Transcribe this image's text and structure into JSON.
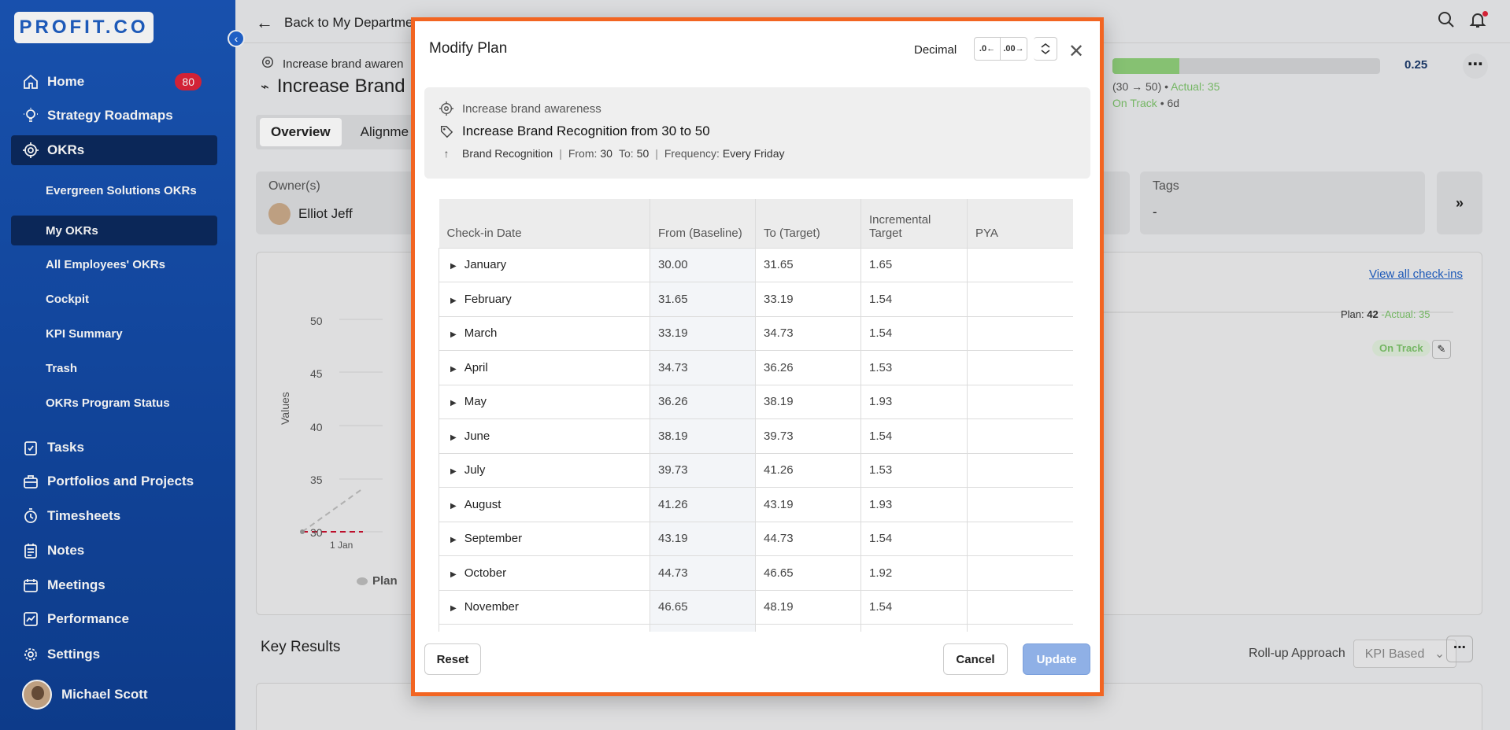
{
  "brand": {
    "logo_text": "PROFIT.CO"
  },
  "sidebar": {
    "items": [
      {
        "label": "Home",
        "badge": "80"
      },
      {
        "label": "Strategy Roadmaps"
      },
      {
        "label": "OKRs"
      },
      {
        "label": "Evergreen Solutions OKRs"
      },
      {
        "label": "My OKRs"
      },
      {
        "label": "All Employees' OKRs"
      },
      {
        "label": "Cockpit"
      },
      {
        "label": "KPI Summary"
      },
      {
        "label": "Trash"
      },
      {
        "label": "OKRs Program Status"
      },
      {
        "label": "Tasks"
      },
      {
        "label": "Portfolios and Projects"
      },
      {
        "label": "Timesheets"
      },
      {
        "label": "Notes"
      },
      {
        "label": "Meetings"
      },
      {
        "label": "Performance"
      },
      {
        "label": "Settings"
      }
    ],
    "user_name": "Michael Scott"
  },
  "topbar": {
    "back_label": "Back to My Departme"
  },
  "page": {
    "objective": "Increase brand awaren",
    "key_result": "Increase Brand",
    "tabs": [
      "Overview",
      "Alignme"
    ],
    "owner_label": "Owner(s)",
    "owner_name": "Elliot Jeff",
    "tags_label": "Tags",
    "tags_value": "-",
    "progress_value": "0.25",
    "progress_fraction": 0.25,
    "progress_range": "(30 → 50)",
    "progress_bullet": "•",
    "actual_text": "Actual: 35",
    "status_text": "On Track",
    "days_text": "6d",
    "view_all": "View all check-ins",
    "chart_y_ticks": [
      "50",
      "45",
      "40",
      "35",
      "30"
    ],
    "chart_y_label": "Values",
    "chart_x_tick": "1 Jan",
    "legend_plan": "Plan",
    "plan_label": "Plan:",
    "plan_value": "42",
    "plan_actual": "-Actual: 35",
    "status_pill": "On Track",
    "key_results_title": "Key Results",
    "rollup_label": "Roll-up Approach",
    "rollup_value": "KPI Based"
  },
  "modal": {
    "title": "Modify Plan",
    "decimal_label": "Decimal",
    "tool_decrease": ".0←",
    "tool_increase": ".00→",
    "summary": {
      "objective": "Increase brand awareness",
      "key_result": "Increase Brand Recognition from 30 to 50",
      "metric": "Brand Recognition",
      "from_label": "From:",
      "from_value": "30",
      "to_label": "To:",
      "to_value": "50",
      "frequency_label": "Frequency:",
      "frequency_value": "Every Friday"
    },
    "columns": [
      "Check-in Date",
      "From (Baseline)",
      "To (Target)",
      "Incremental Target",
      "PYA"
    ],
    "rows": [
      {
        "month": "January",
        "from": "30.00",
        "to": "31.65",
        "inc": "1.65",
        "pya": ""
      },
      {
        "month": "February",
        "from": "31.65",
        "to": "33.19",
        "inc": "1.54",
        "pya": ""
      },
      {
        "month": "March",
        "from": "33.19",
        "to": "34.73",
        "inc": "1.54",
        "pya": ""
      },
      {
        "month": "April",
        "from": "34.73",
        "to": "36.26",
        "inc": "1.53",
        "pya": ""
      },
      {
        "month": "May",
        "from": "36.26",
        "to": "38.19",
        "inc": "1.93",
        "pya": ""
      },
      {
        "month": "June",
        "from": "38.19",
        "to": "39.73",
        "inc": "1.54",
        "pya": ""
      },
      {
        "month": "July",
        "from": "39.73",
        "to": "41.26",
        "inc": "1.53",
        "pya": ""
      },
      {
        "month": "August",
        "from": "41.26",
        "to": "43.19",
        "inc": "1.93",
        "pya": ""
      },
      {
        "month": "September",
        "from": "43.19",
        "to": "44.73",
        "inc": "1.54",
        "pya": ""
      },
      {
        "month": "October",
        "from": "44.73",
        "to": "46.65",
        "inc": "1.92",
        "pya": ""
      },
      {
        "month": "November",
        "from": "46.65",
        "to": "48.19",
        "inc": "1.54",
        "pya": ""
      },
      {
        "month": "",
        "from": "",
        "to": "",
        "inc": "",
        "pya": ""
      }
    ],
    "reset_label": "Reset",
    "cancel_label": "Cancel",
    "update_label": "Update"
  },
  "colors": {
    "accent": "#1f5fc4",
    "modal_border": "#f26522",
    "on_track": "#7cc26a",
    "badge": "#e0253a"
  }
}
